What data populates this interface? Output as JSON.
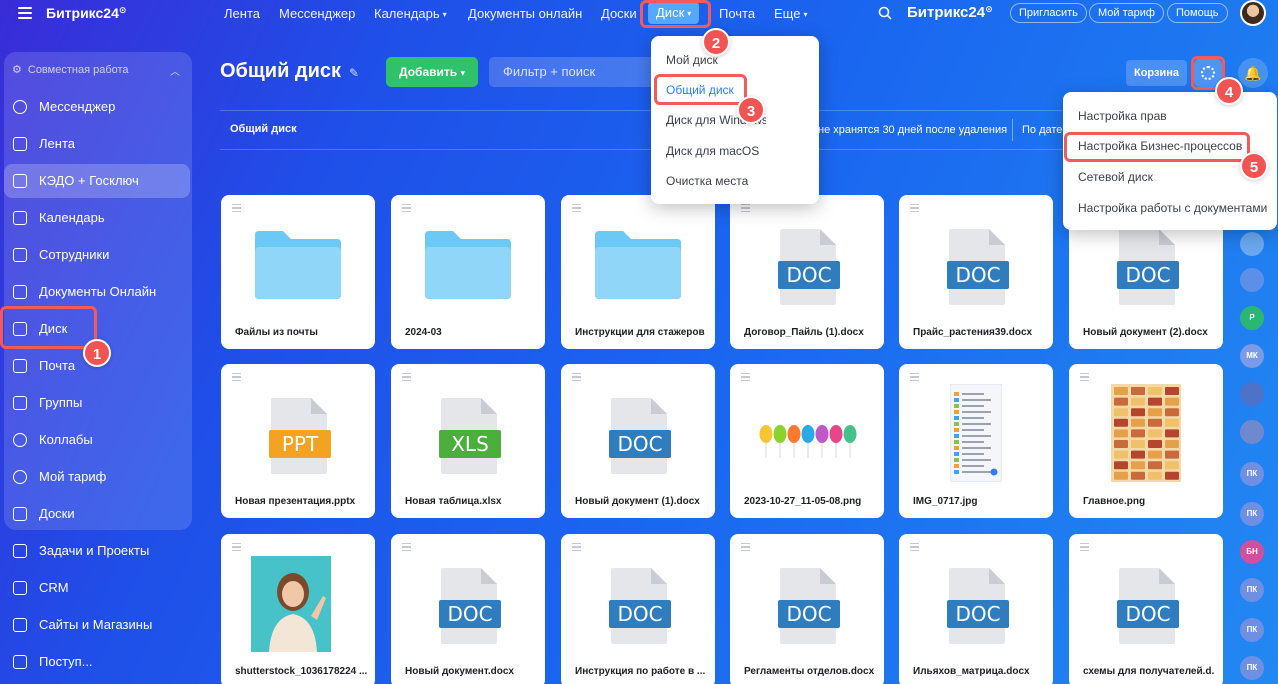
{
  "topbar": {
    "brand": "Битрикс24",
    "nav": [
      {
        "label": "Лента",
        "caret": false
      },
      {
        "label": "Мессенджер",
        "caret": false
      },
      {
        "label": "Календарь",
        "caret": true
      },
      {
        "label": "Документы онлайн",
        "caret": false
      },
      {
        "label": "Доски",
        "caret": false
      },
      {
        "label": "Диск",
        "caret": true,
        "active": true
      },
      {
        "label": "Почта",
        "caret": false
      },
      {
        "label": "Еще",
        "caret": true
      }
    ],
    "brand_right": "Битрикс24",
    "invite_label": "Пригласить",
    "tariff_label": "Мой тариф",
    "help_label": "Помощь"
  },
  "sidebar": {
    "group_label": "Совместная работа",
    "items": [
      {
        "label": "Мессенджер",
        "icon": "messenger-icon"
      },
      {
        "label": "Лента",
        "icon": "feed-icon"
      },
      {
        "label": "КЭДО + Госключ",
        "icon": "kedo-icon"
      },
      {
        "label": "Календарь",
        "icon": "calendar-icon"
      },
      {
        "label": "Сотрудники",
        "icon": "employees-icon"
      },
      {
        "label": "Документы Онлайн",
        "icon": "documents-icon"
      },
      {
        "label": "Диск",
        "icon": "disk-icon"
      },
      {
        "label": "Почта",
        "icon": "mail-icon"
      },
      {
        "label": "Группы",
        "icon": "groups-icon"
      },
      {
        "label": "Коллабы",
        "icon": "collabs-icon"
      },
      {
        "label": "Мой тариф",
        "icon": "tariff-icon"
      },
      {
        "label": "Доски",
        "icon": "boards-icon"
      },
      {
        "label": "Задачи и Проекты",
        "icon": "tasks-icon"
      },
      {
        "label": "CRM",
        "icon": "crm-icon"
      },
      {
        "label": "Сайты и Магазины",
        "icon": "sites-icon"
      },
      {
        "label": "Поступ...",
        "icon": "more-icon"
      }
    ]
  },
  "header": {
    "title": "Общий диск",
    "add_label": "Добавить",
    "filter_placeholder": "Фильтр + поиск",
    "trash_label": "Корзина"
  },
  "toolbar": {
    "breadcrumb": "Общий диск",
    "trash_note": "не хранятся 30 дней после удаления",
    "sort_label": "По дате"
  },
  "files": [
    {
      "name": "Файлы из почты",
      "type": "folder"
    },
    {
      "name": "2024-03",
      "type": "folder"
    },
    {
      "name": "Инструкции для стажеров",
      "type": "folder"
    },
    {
      "name": "Договор_Пайль (1).docx",
      "type": "doc",
      "badge": "DOC"
    },
    {
      "name": "Прайс_растения39.docx",
      "type": "doc",
      "badge": "DOC"
    },
    {
      "name": "Новый документ (2).docx",
      "type": "doc",
      "badge": "DOC"
    },
    {
      "name": "Новая презентация.pptx",
      "type": "ppt",
      "badge": "PPT"
    },
    {
      "name": "Новая таблица.xlsx",
      "type": "xls",
      "badge": "XLS"
    },
    {
      "name": "Новый документ (1).docx",
      "type": "doc",
      "badge": "DOC"
    },
    {
      "name": "2023-10-27_11-05-08.png",
      "type": "balloons"
    },
    {
      "name": "IMG_0717.jpg",
      "type": "screenshot"
    },
    {
      "name": "Главное.png",
      "type": "poster"
    },
    {
      "name": "shutterstock_1036178224 ...",
      "type": "photo"
    },
    {
      "name": "Новый документ.docx",
      "type": "doc",
      "badge": "DOC"
    },
    {
      "name": "Инструкция по работе в ...",
      "type": "doc",
      "badge": "DOC"
    },
    {
      "name": "Регламенты отделов.docx",
      "type": "doc",
      "badge": "DOC"
    },
    {
      "name": "Ильяхов_матрица.docx",
      "type": "doc",
      "badge": "DOC"
    },
    {
      "name": "схемы для получателей.d...",
      "type": "doc",
      "badge": "DOC"
    }
  ],
  "disk_menu": {
    "items": [
      "Мой диск",
      "Общий диск",
      "Диск для Windows",
      "Диск для macOS",
      "Очистка места"
    ],
    "selected_index": 1
  },
  "settings_menu": {
    "items": [
      "Настройка прав",
      "Настройка Бизнес-процессов",
      "Сетевой диск",
      "Настройка работы с документами"
    ]
  },
  "right_avatars": [
    "",
    "",
    "Р",
    "МК",
    "",
    "",
    "ПК",
    "ПК",
    "БН",
    "ПК",
    "ПК",
    "ПК"
  ],
  "markers": [
    "1",
    "2",
    "3",
    "4",
    "5"
  ],
  "colors": {
    "accent_green": "#2fc26b",
    "marker_red": "#f25454",
    "folder_blue": "#6cc9f5",
    "doc_blue": "#2f7cbf",
    "ppt_orange": "#f3a321",
    "xls_green": "#4cae3c",
    "selected_blue": "#2f7cf6"
  }
}
